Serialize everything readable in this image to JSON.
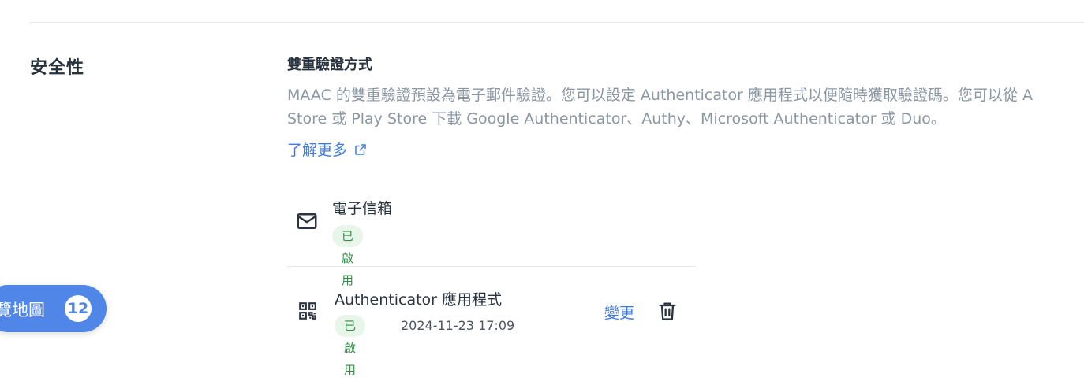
{
  "section": {
    "label": "安全性"
  },
  "two_factor": {
    "heading": "雙重驗證方式",
    "description": "MAAC 的雙重驗證預設為電子郵件驗證。您可以設定 Authenticator 應用程式以便隨時獲取驗證碼。您可以從 A\nStore 或 Play Store 下載 Google Authenticator、Authy、Microsoft Authenticator 或 Duo。",
    "learn_more": "了解更多",
    "learn_more_icon": "external-link-icon",
    "methods": [
      {
        "name": "電子信箱",
        "status": "已啟用",
        "icon": "mail-icon"
      },
      {
        "name": "Authenticator 應用程式",
        "status": "已啟用",
        "timestamp": "2024-11-23 17:09",
        "icon": "qr-code-icon",
        "change_label": "變更",
        "delete_icon": "trash-icon"
      }
    ]
  },
  "sitemap": {
    "label": "覽地圖",
    "count": "12"
  },
  "colors": {
    "accent": "#3d7be0",
    "badge_bg": "#e8f6ea",
    "badge_text": "#2f8f45",
    "pill_bg": "#4f86e8"
  }
}
